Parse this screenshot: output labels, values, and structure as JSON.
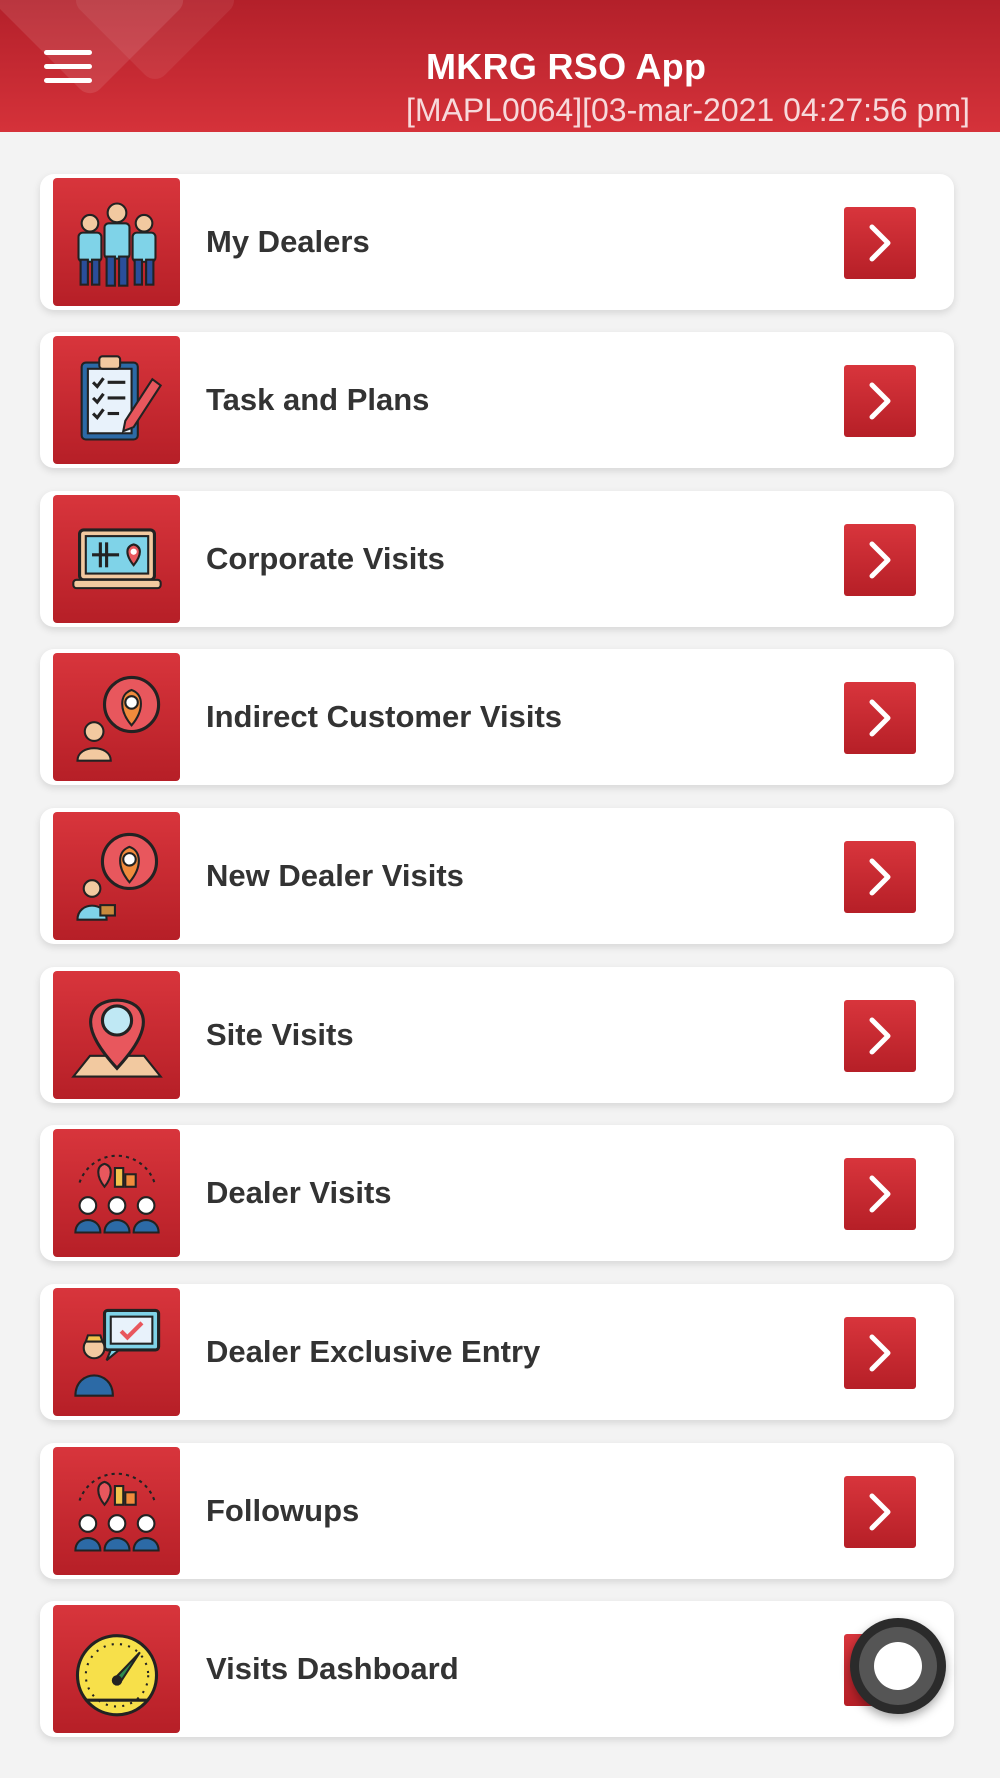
{
  "header": {
    "title": "MKRG RSO App",
    "subtitle": "[MAPL0064][03-mar-2021 04:27:56 pm]",
    "menu_icon": "hamburger-menu-icon"
  },
  "menu": {
    "items": [
      {
        "label": "My Dealers",
        "icon": "people-group-icon"
      },
      {
        "label": "Task and Plans",
        "icon": "clipboard-checklist-icon"
      },
      {
        "label": "Corporate Visits",
        "icon": "laptop-map-pin-icon"
      },
      {
        "label": "Indirect Customer Visits",
        "icon": "person-location-pin-icon"
      },
      {
        "label": "New Dealer Visits",
        "icon": "dealer-location-pin-icon"
      },
      {
        "label": "Site Visits",
        "icon": "location-pin-map-icon"
      },
      {
        "label": "Dealer Visits",
        "icon": "dealer-network-icon"
      },
      {
        "label": "Dealer Exclusive Entry",
        "icon": "person-chat-check-icon"
      },
      {
        "label": "Followups",
        "icon": "dealer-network-icon"
      },
      {
        "label": "Visits Dashboard",
        "icon": "speedometer-gauge-icon"
      }
    ],
    "arrow_icon": "chevron-right-icon"
  },
  "colors": {
    "brand_red": "#c9272f",
    "header_top": "#b3202a",
    "background": "#f3f3f3"
  }
}
